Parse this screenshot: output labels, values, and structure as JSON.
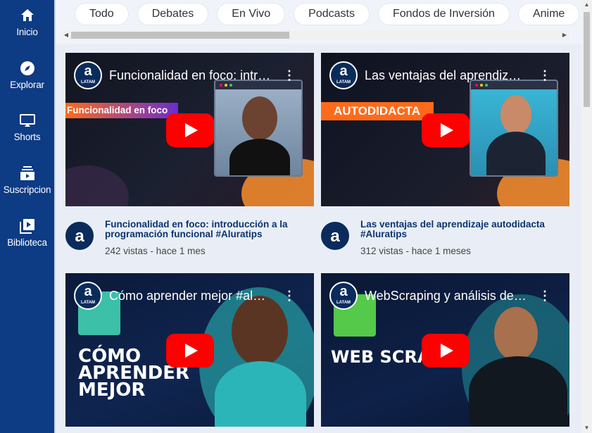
{
  "sidebar": {
    "items": [
      {
        "label": "Inicio",
        "icon": "home-icon"
      },
      {
        "label": "Explorar",
        "icon": "compass-icon"
      },
      {
        "label": "Shorts",
        "icon": "shorts-icon"
      },
      {
        "label": "Suscripcion",
        "icon": "subscriptions-icon"
      },
      {
        "label": "Biblioteca",
        "icon": "library-icon"
      }
    ]
  },
  "chips": [
    "Todo",
    "Debates",
    "En Vivo",
    "Podcasts",
    "Fondos de Inversión",
    "Anime"
  ],
  "channel": {
    "logo_letter": "a",
    "logo_sub": "LATAM"
  },
  "videos": [
    {
      "thumb_title": "Funcionalidad en foco: intr…",
      "overlay": "Funcionalidad en foco",
      "title": "Funcionalidad en foco: introducción a la programación funcional #Aluratips",
      "views": "242 vistas",
      "age": "hace 1 mes",
      "separator": " - "
    },
    {
      "thumb_title": "Las ventajas del aprendizaj…",
      "overlay": "AUTODIDACTA",
      "title": "Las ventajas del aprendizaje autodidacta #Aluratips",
      "views": "312 vistas",
      "age": "hace 1 meses",
      "separator": " - "
    },
    {
      "thumb_title": "Cómo aprender mejor #alu…",
      "overlay": "CÓMO APRENDER MEJOR",
      "title": "",
      "views": "",
      "age": "",
      "separator": ""
    },
    {
      "thumb_title": "WebScraping y análisis de …",
      "overlay": "WEB SCRA",
      "title": "",
      "views": "",
      "age": "",
      "separator": ""
    }
  ],
  "colors": {
    "sidebar_bg": "#0d3b84",
    "main_bg": "#e9eef6",
    "play_button": "#ff0000",
    "title_text": "#0a3470"
  }
}
